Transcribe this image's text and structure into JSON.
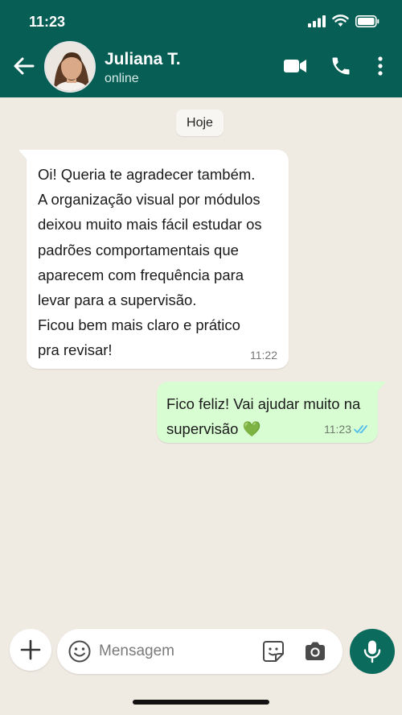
{
  "status_bar": {
    "time": "11:23"
  },
  "header": {
    "contact_name": "Juliana T.",
    "contact_status": "online"
  },
  "chat": {
    "date_chip": "Hoje",
    "messages": [
      {
        "direction": "incoming",
        "lines": [
          "Oi! Queria te agradecer também.",
          "A organização visual por módulos",
          "deixou muito mais fácil estudar os",
          "padrões comportamentais que",
          "aparecem com frequência para",
          "levar para a supervisão.",
          "Ficou bem mais claro e prático",
          "pra revisar!"
        ],
        "time": "11:22"
      },
      {
        "direction": "outgoing",
        "lines": [
          "Fico feliz! Vai ajudar muito na",
          "supervisão 💚"
        ],
        "time": "11:23",
        "read_receipt": "double-check-blue"
      }
    ]
  },
  "input_bar": {
    "placeholder": "Mensagem"
  },
  "colors": {
    "header_bg": "#075e54",
    "chat_bg": "#efeae2",
    "incoming_bubble": "#ffffff",
    "outgoing_bubble": "#d9fdd3",
    "accent": "#0b6b5c",
    "read_tick": "#53bdeb"
  }
}
